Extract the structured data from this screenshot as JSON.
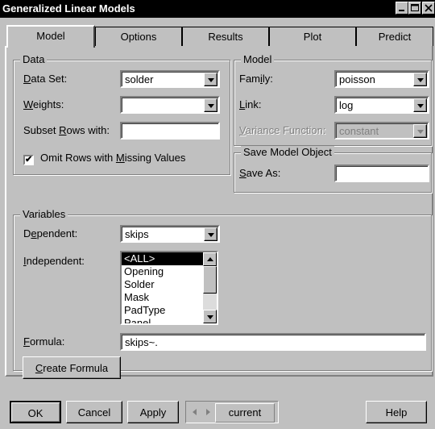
{
  "window": {
    "title": "Generalized Linear Models",
    "minimize_icon": "minimize-icon",
    "maximize_icon": "maximize-icon",
    "close_icon": "close-icon"
  },
  "tabs": [
    {
      "label": "Model",
      "active": true
    },
    {
      "label": "Options"
    },
    {
      "label": "Results"
    },
    {
      "label": "Plot"
    },
    {
      "label": "Predict"
    }
  ],
  "data_group": {
    "title": "Data",
    "data_set_label_u": "D",
    "data_set_label_rest": "ata Set:",
    "data_set_value": "solder",
    "weights_label_u": "W",
    "weights_label_rest": "eights:",
    "weights_value": "",
    "subset_label_pre": "Subset ",
    "subset_label_u": "R",
    "subset_label_rest": "ows with:",
    "subset_value": "",
    "omit_label_pre": "Omit Rows with ",
    "omit_label_u": "M",
    "omit_label_rest": "issing Values",
    "omit_checked": "✔"
  },
  "model_group": {
    "title": "Model",
    "family_label_pre": "Fam",
    "family_label_u": "i",
    "family_label_rest": "ly:",
    "family_value": "poisson",
    "link_label_u": "L",
    "link_label_rest": "ink:",
    "link_value": "log",
    "variance_label_u": "V",
    "variance_label_rest": "ariance Function:",
    "variance_value": "constant"
  },
  "save_group": {
    "title": "Save Model Object",
    "save_as_label_u": "S",
    "save_as_label_rest": "ave As:",
    "save_as_value": ""
  },
  "variables_group": {
    "title": "Variables",
    "dependent_label_pre": "D",
    "dependent_label_u": "e",
    "dependent_label_rest": "pendent:",
    "dependent_value": "skips",
    "independent_label_u": "I",
    "independent_label_rest": "ndependent:",
    "independent_items": [
      "<ALL>",
      "Opening",
      "Solder",
      "Mask",
      "PadType",
      "Panel"
    ],
    "independent_selected": "<ALL>",
    "formula_label_u": "F",
    "formula_label_rest": "ormula:",
    "formula_value": "skips~.",
    "create_formula_u": "C",
    "create_formula_rest": "reate Formula"
  },
  "footer": {
    "ok": "OK",
    "cancel": "Cancel",
    "apply": "Apply",
    "page_value": "current",
    "help": "Help"
  }
}
